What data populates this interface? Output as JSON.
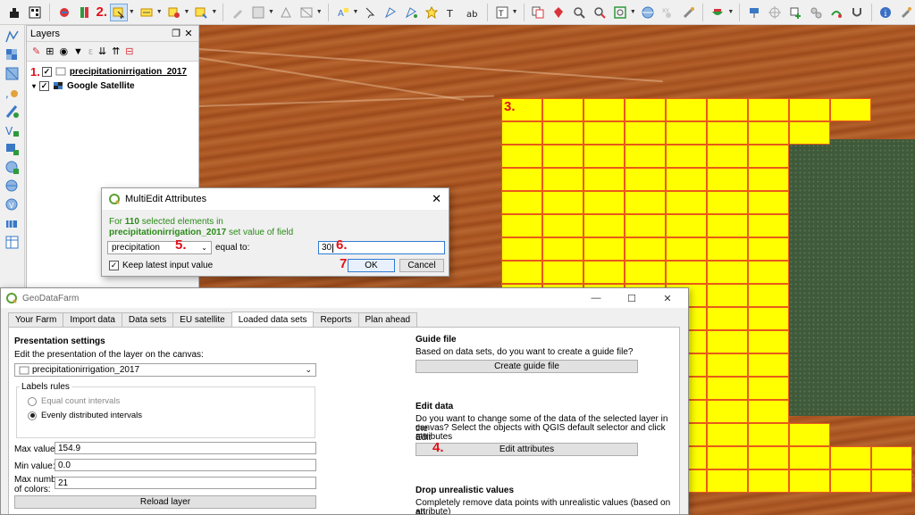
{
  "annotations": {
    "n1": "1.",
    "n2": "2.",
    "n3": "3.",
    "n4": "4.",
    "n5": "5.",
    "n6": "6.",
    "n7": "7."
  },
  "layers_panel": {
    "title": "Layers",
    "layers": [
      {
        "name": "precipitationirrigation_2017",
        "checked": true,
        "icon": "polygon-layer-icon"
      },
      {
        "name": "Google Satellite",
        "checked": true,
        "icon": "raster-layer-icon"
      }
    ]
  },
  "multiedit_dialog": {
    "title": "MultiEdit Attributes",
    "msg_prefix": "For",
    "count": "110",
    "msg_middle": "selected elements in",
    "layer": "precipitationirrigation_2017",
    "msg_suffix": "set value of field",
    "field_value": "precipitation",
    "equal_to_label": "equal to:",
    "input_value": "30",
    "keep_label": "Keep latest input value",
    "keep_checked": true,
    "ok_label": "OK",
    "cancel_label": "Cancel"
  },
  "geodatafarm": {
    "title": "GeoDataFarm",
    "tabs": [
      "Your Farm",
      "Import data",
      "Data sets",
      "EU satellite",
      "Loaded data sets",
      "Reports",
      "Plan ahead"
    ],
    "active_tab": "Loaded data sets",
    "presentation": {
      "heading": "Presentation settings",
      "edit_label": "Edit the presentation of the layer on the canvas:",
      "layer_select": "precipitationirrigation_2017",
      "labels_rules": "Labels rules",
      "radio_equal": "Equal count intervals",
      "radio_even": "Evenly distributed intervals",
      "selected_rule": "Evenly distributed intervals",
      "max_label": "Max value:",
      "max_value": "154.9",
      "min_label": "Min value:",
      "min_value": "0.0",
      "maxnum_label_1": "Max number",
      "maxnum_label_2": "of colors:",
      "maxnum_value": "21",
      "reload_label": "Reload layer"
    },
    "guide": {
      "heading": "Guide file",
      "text": "Based on data sets, do you want to create a guide file?",
      "button": "Create guide file"
    },
    "edit": {
      "heading": "Edit data",
      "text_1": "Do you want to change some of the data of the selected layer in the",
      "text_2": "canvas? Select the objects with QGIS default selector and click Edit",
      "text_3": "attributes",
      "button": "Edit attributes"
    },
    "drop": {
      "heading": "Drop unrealistic values",
      "text_1": "Completely remove data points with unrealistic values (based on an",
      "text_2": "attribute)"
    }
  },
  "colors": {
    "selection_fill": "#ffff00",
    "grid_line": "#e85a1a",
    "annotation": "#e0101a",
    "message_green": "#2b8a1a"
  }
}
